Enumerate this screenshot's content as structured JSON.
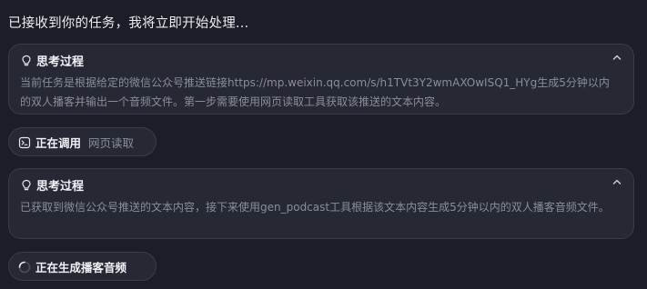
{
  "intro": {
    "text": "已接收到你的任务，我将立即开始处理..."
  },
  "thinking_1": {
    "icon": "lightbulb-icon",
    "title": "思考过程",
    "body": "当前任务是根据给定的微信公众号推送链接https://mp.weixin.qq.com/s/h1TVt3Y2wmAXOwISQ1_HYg生成5分钟以内的双人播客并输出一个音频文件。第一步需要使用网页读取工具获取该推送的文本内容。"
  },
  "tool_call": {
    "icon": "terminal-icon",
    "label": "正在调用",
    "tool_name": "网页读取"
  },
  "thinking_2": {
    "icon": "lightbulb-icon",
    "title": "思考过程",
    "body": "已获取到微信公众号推送的文本内容，接下来使用gen_podcast工具根据该文本内容生成5分钟以内的双人播客音频文件。"
  },
  "generating": {
    "icon": "spinner-icon",
    "label": "正在生成播客音频"
  },
  "colors": {
    "background": "#1c1d26",
    "card": "#262833",
    "border": "#3a3c4a",
    "muted_text": "#8a8d9c"
  }
}
